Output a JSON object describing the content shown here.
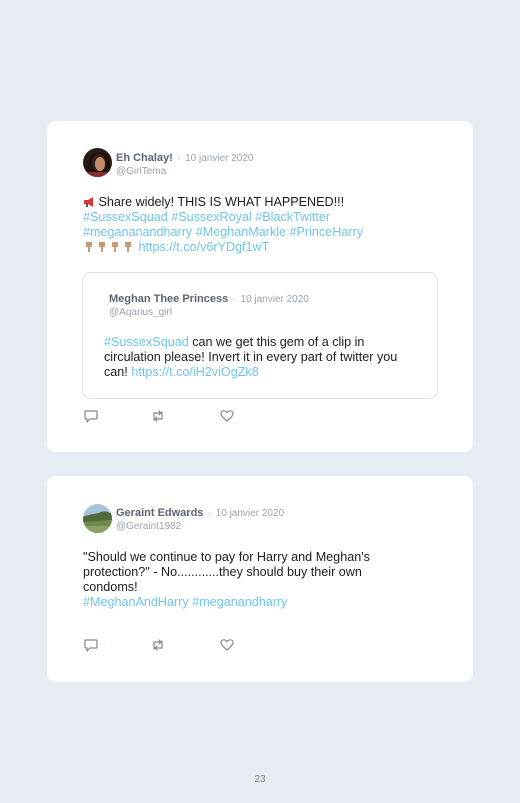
{
  "tweets": [
    {
      "author_name": "Eh Chalay!",
      "separator": "·",
      "date": "10 janvier 2020",
      "handle": "@GirlTema",
      "line1_text": "Share widely! THIS IS WHAT HAPPENED!!!",
      "hashtags_line1": "#SussexSquad #SussexRoyal #BlackTwitter",
      "hashtags_line2": "#megananandharry #MeghanMarkle #PrinceHarry",
      "link": "https://t.co/v6rYDgf1wT",
      "megaphone_icon": "megaphone-icon",
      "hand_icon": "pointing-down-hand-icon",
      "quoted": {
        "author_name": "Meghan Thee Princess",
        "separator": "·",
        "date": "10 janvier 2020",
        "handle": "@Aqarius_girl",
        "hashtag": "#SussexSquad",
        "text1": " can we get this gem of a clip in",
        "text2": "circulation please! Invert it in every part of twitter you",
        "text3": "can! ",
        "link": "https://t.co/iH2viOgZk8"
      }
    },
    {
      "author_name": "Geraint Edwards",
      "separator": "·",
      "date": "10 janvier 2020",
      "handle": "@Geraint1982",
      "line1": "\"Should we continue to pay for Harry and Meghan's",
      "line2": "protection?\" - No............they should buy their own",
      "line3": "condoms!",
      "hashtags": "#MeghanAndHarry #meganandharry"
    }
  ],
  "action_icons": [
    "reply-icon",
    "retweet-icon",
    "like-icon"
  ],
  "colors": {
    "background": "#e7ebf2",
    "card": "#ffffff",
    "hashtag": "#6ec5ee",
    "name": "#5a6473",
    "meta": "#9aa3ad"
  },
  "page_number": "23"
}
